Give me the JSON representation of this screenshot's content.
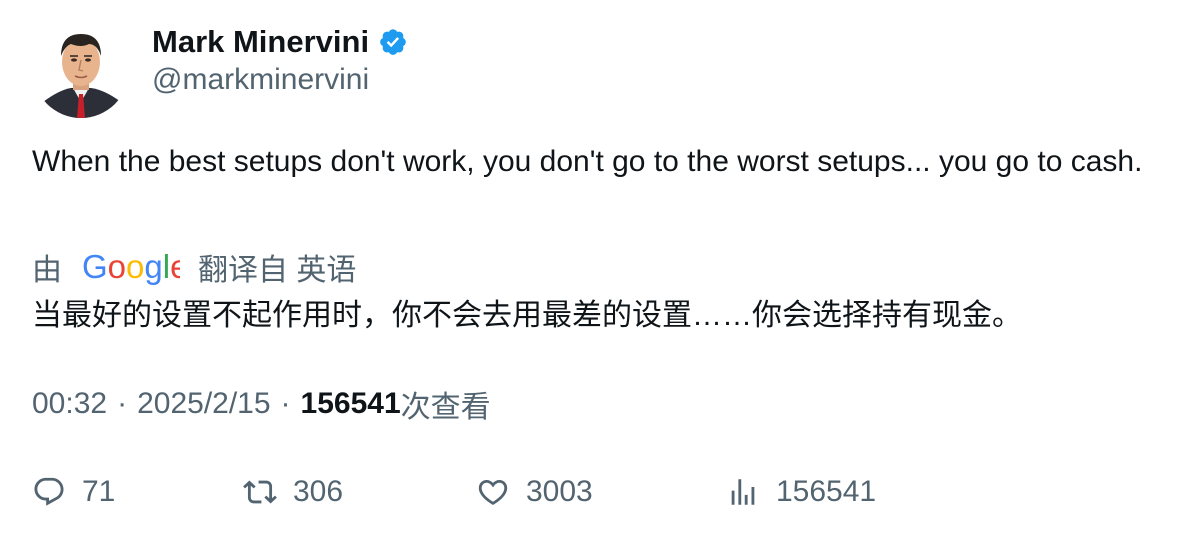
{
  "author": {
    "display_name": "Mark Minervini",
    "handle": "@markminervini",
    "verified_icon": "verified-badge-icon",
    "badge_color": "#1d9bf0"
  },
  "tweet": {
    "text": "When the best setups don't work, you don't go to the worst setups... you go to cash."
  },
  "translation": {
    "by_label": "由",
    "provider": "Google",
    "from_label": "翻译自 英语",
    "text": "当最好的设置不起作用时，你不会去用最差的设置……你会选择持有现金。"
  },
  "meta": {
    "time": "00:32",
    "separator": "·",
    "date": "2025/2/15",
    "views": "156541",
    "views_label": "次查看"
  },
  "actions": {
    "replies": "71",
    "retweets": "306",
    "likes": "3003",
    "views": "156541"
  },
  "colors": {
    "text_primary": "#0f1419",
    "text_secondary": "#536471"
  }
}
